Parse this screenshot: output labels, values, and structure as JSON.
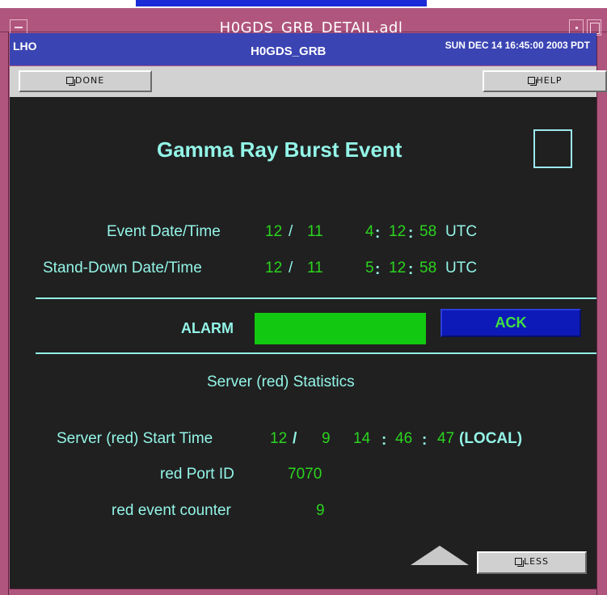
{
  "window": {
    "title": "H0GDS_GRB_DETAIL.adl",
    "frame_color": "#b0567e"
  },
  "header": {
    "site": "LHO",
    "name": "H0GDS_GRB",
    "datetime": "SUN DEC 14 16:45:00 2003 PDT"
  },
  "buttons": {
    "done": "DONE",
    "help": "HELP",
    "less": "LESS",
    "ack": "ACK"
  },
  "main": {
    "title": "Gamma Ray Burst Event",
    "event": {
      "label": "Event Date/Time",
      "month": "12",
      "sep": "/",
      "day": "11",
      "hour": "4",
      "colon": ":",
      "min": "12",
      "sec": "58",
      "tz": "UTC"
    },
    "standdown": {
      "label": "Stand-Down Date/Time",
      "month": "12",
      "sep": "/",
      "day": "11",
      "hour": "5",
      "colon": ":",
      "min": "12",
      "sec": "58",
      "tz": "UTC"
    },
    "alarm": {
      "label": "ALARM",
      "color": "#12c810"
    },
    "stats_title": "Server (red) Statistics",
    "server_start": {
      "label": "Server (red) Start Time",
      "month": "12",
      "sep": "/",
      "day": "9",
      "hour": "14",
      "colon": ":",
      "min": "46",
      "sec": "47",
      "tz": "(LOCAL)"
    },
    "port": {
      "label": "red Port ID",
      "value": "7070"
    },
    "counter": {
      "label": "red event counter",
      "value": "9"
    }
  },
  "colors": {
    "background": "#202020",
    "label_cyan": "#93f5e7",
    "value_green": "#2bd41f",
    "header_blue": "#3b44b3",
    "ack_blue": "#0d1ab8"
  }
}
